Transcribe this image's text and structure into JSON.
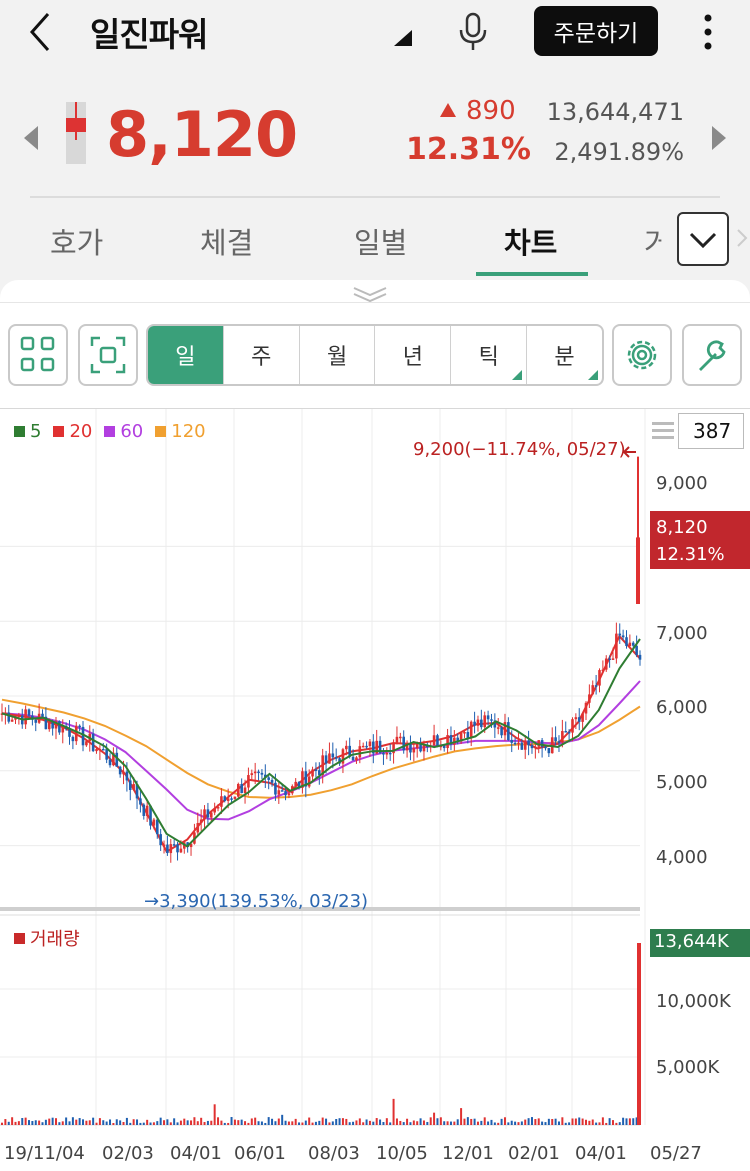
{
  "header": {
    "title": "일진파워",
    "order_label": "주문하기"
  },
  "quote": {
    "price": "8,120",
    "change": "890",
    "change_pct": "12.31%",
    "volume": "13,644,471",
    "volume_pct": "2,491.89%"
  },
  "tabs": [
    {
      "label": "호가"
    },
    {
      "label": "체결"
    },
    {
      "label": "일별"
    },
    {
      "label": "차트"
    },
    {
      "label": "거래"
    }
  ],
  "periods": [
    "일",
    "주",
    "월",
    "년",
    "틱",
    "분"
  ],
  "chart_data": {
    "type": "candlestick",
    "legend": [
      "5",
      "20",
      "60",
      "120"
    ],
    "legend_colors": {
      "5": "#2f7d32",
      "20": "#e03131",
      "60": "#b23fe0",
      "120": "#f0a030"
    },
    "zoom_count": "387",
    "y_ticks": [
      "9,000",
      "7,000",
      "6,000",
      "5,000",
      "4,000"
    ],
    "x_ticks": [
      "19/11/04",
      "02/03",
      "04/01",
      "06/01",
      "08/03",
      "10/05",
      "12/01",
      "02/01",
      "04/01",
      "05/27"
    ],
    "current_price": "8,120",
    "current_pct": "12.31%",
    "high_annotation": "9,200(−11.74%, 05/27)",
    "low_annotation": "3,390(139.53%, 03/23)",
    "ma_20": [
      5770,
      5730,
      5680,
      5580,
      5430,
      5230,
      4950,
      4450,
      3920,
      4080,
      4420,
      4650,
      4880,
      4840,
      4720,
      4980,
      5150,
      5260,
      5300,
      5370,
      5360,
      5400,
      5470,
      5620,
      5640,
      5440,
      5300,
      5360,
      5650,
      6200,
      6800,
      6500
    ],
    "ma_60": [
      5770,
      5750,
      5710,
      5640,
      5550,
      5420,
      5250,
      5000,
      4750,
      4480,
      4360,
      4350,
      4460,
      4620,
      4720,
      4840,
      4980,
      5120,
      5210,
      5270,
      5300,
      5330,
      5360,
      5400,
      5400,
      5400,
      5380,
      5360,
      5420,
      5610,
      5900,
      6200
    ],
    "ma_120": [
      5950,
      5900,
      5840,
      5780,
      5700,
      5600,
      5470,
      5330,
      5150,
      4970,
      4820,
      4720,
      4650,
      4640,
      4650,
      4680,
      4740,
      4820,
      4930,
      5030,
      5110,
      5190,
      5260,
      5300,
      5330,
      5350,
      5360,
      5380,
      5420,
      5520,
      5680,
      5860
    ],
    "volume_legend": "거래량",
    "volume_ticks": [
      "10,000K",
      "5,000K"
    ],
    "current_volume": "13,644K"
  }
}
